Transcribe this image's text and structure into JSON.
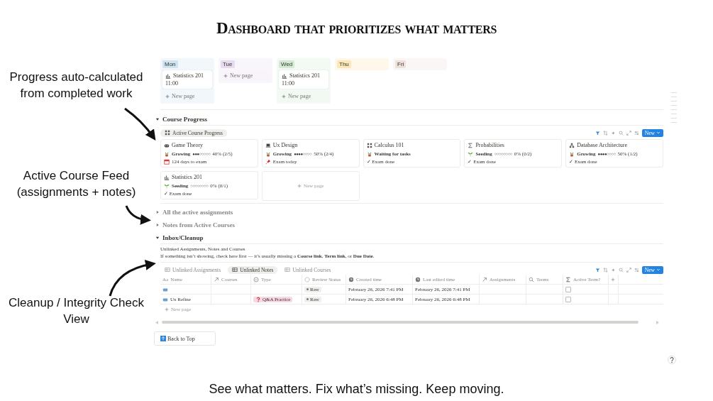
{
  "title": "Dashboard that prioritizes what matters",
  "annotations": [
    {
      "text": "Progress auto-calculated from completed work"
    },
    {
      "text": "Active Course Feed (assignments + notes)"
    },
    {
      "text": "Cleanup / Integrity Check View"
    }
  ],
  "week": [
    {
      "day": "Mon",
      "color": "#cfe3f0",
      "entries": [
        {
          "title": "Statistics 201",
          "time": "11:00"
        }
      ],
      "new_page": "New page"
    },
    {
      "day": "Tue",
      "color": "#e6dbef",
      "new_page": "New page"
    },
    {
      "day": "Wed",
      "color": "#d5ead5",
      "entries": [
        {
          "title": "Statistics 201",
          "time": "11:00"
        }
      ],
      "new_page": "New page"
    },
    {
      "day": "Thu",
      "color": "#fbe7b8"
    },
    {
      "day": "Fri",
      "color": "#eee0da"
    }
  ],
  "course_progress": {
    "heading": "Course Progress",
    "expanded": true,
    "view_tab": "Active Course Progress",
    "new_button": "New",
    "cards": [
      {
        "title": "Game Theory",
        "status": "Growing",
        "dots": "●●●○○○○○",
        "progress": "40% (2/5)",
        "note": "124 days to exam"
      },
      {
        "title": "Ux Design",
        "status": "Growing",
        "dots": "●●●●○○○○",
        "progress": "50% (2/4)",
        "note": "Exam today"
      },
      {
        "title": "Calculus 101",
        "status": "Waiting for tasks",
        "note": "✓ Exam done"
      },
      {
        "title": "Probabilities",
        "status": "Seeding",
        "dots": "○○○○○○○○",
        "progress": "0% (0/2)",
        "note": "✓ Exam done"
      },
      {
        "title": "Database Architecture",
        "status": "Growing",
        "dots": "●●●●○○○○",
        "progress": "50% (1/2)",
        "note": "✓ Exam done"
      },
      {
        "title": "Statistics 201",
        "status": "Seeding",
        "dots": "○○○○○○○○",
        "progress": "0% (0/1)",
        "note": "✓ Exam done"
      }
    ],
    "new_page": "New page"
  },
  "sections": [
    {
      "heading": "All the active assignments",
      "expanded": false
    },
    {
      "heading": "Notes from Active Courses",
      "expanded": false
    }
  ],
  "inbox": {
    "heading": "Inbox/Cleanup",
    "expanded": true,
    "description": [
      "Unlinked Assignments, Notes and Courses",
      "If something isn’t showing, check here first — it’s usually missing a **Course link**, **Term link**, or **Due Date**."
    ],
    "tabs": [
      {
        "label": "Unlinked Assignments",
        "selected": false
      },
      {
        "label": "Unlinked Notes",
        "selected": true
      },
      {
        "label": "Unlinked Courses",
        "selected": false
      }
    ],
    "new_button": "New",
    "columns": [
      {
        "label": "Name",
        "prefix": "Aa"
      },
      {
        "label": "Courses"
      },
      {
        "label": "Type"
      },
      {
        "label": "Review Status"
      },
      {
        "label": "Created time"
      },
      {
        "label": "Last edited time"
      },
      {
        "label": "Assignments"
      },
      {
        "label": "Terms"
      },
      {
        "label": "Active Term?"
      }
    ],
    "rows": [
      {
        "review": "Raw",
        "created": "February 26, 2026 7:41 PM",
        "edited": "February 26, 2026 7:41 PM",
        "active_term": false
      },
      {
        "name": "Ux Refine",
        "type": "Q&A Practice",
        "review": "Raw",
        "created": "February 26, 2026 6:48 PM",
        "edited": "February 26, 2026 6:48 PM",
        "active_term": false
      }
    ],
    "new_page": "New page"
  },
  "back_to_top": "Back to Top",
  "caption": "See what matters. Fix what’s missing. Keep moving."
}
